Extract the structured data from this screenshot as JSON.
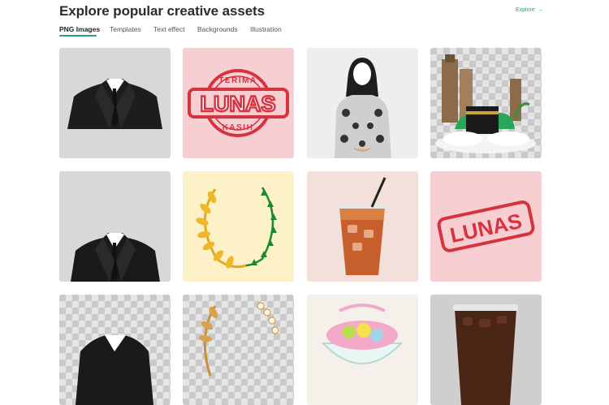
{
  "header": {
    "title": "Explore popular creative assets",
    "explore_label": "Explore",
    "explore_arrow": "→"
  },
  "tabs": [
    {
      "label": "PNG Images",
      "active": true
    },
    {
      "label": "Templates",
      "active": false
    },
    {
      "label": "Text effect",
      "active": false
    },
    {
      "label": "Backgrounds",
      "active": false
    },
    {
      "label": "Illustration",
      "active": false
    }
  ],
  "colors": {
    "accent": "#25a56a",
    "stamp_red": "#d6333f",
    "card_pink": "#f7cfd3",
    "card_gray": "#d8d8d8",
    "card_cream": "#fdf1c8",
    "card_peach": "#f3e0db"
  },
  "cards": [
    {
      "name": "suit-png-card",
      "icon": "black-suit-image"
    },
    {
      "name": "lunas-terima-kasih-stamp-card",
      "icon": "lunas-stamp-image",
      "stamp_top": "TERIMA",
      "stamp_main": "LUNAS",
      "stamp_bottom": "KASIH"
    },
    {
      "name": "hijab-batik-card",
      "icon": "hijab-woman-image"
    },
    {
      "name": "kaaba-mecca-card",
      "icon": "kaaba-image"
    },
    {
      "name": "suit-png-card-2",
      "icon": "black-suit-image"
    },
    {
      "name": "laurel-wreath-card",
      "icon": "laurel-wreath-image"
    },
    {
      "name": "iced-tea-card",
      "icon": "iced-tea-image"
    },
    {
      "name": "lunas-stamp-card",
      "icon": "lunas-stamp-image",
      "stamp_main": "LUNAS"
    },
    {
      "name": "suit-png-card-3",
      "icon": "black-suit-image"
    },
    {
      "name": "gold-wreath-card",
      "icon": "laurel-wreath-image"
    },
    {
      "name": "dessert-bowl-card",
      "icon": "dessert-bowl-image"
    },
    {
      "name": "iced-coffee-card",
      "icon": "iced-coffee-image"
    }
  ]
}
